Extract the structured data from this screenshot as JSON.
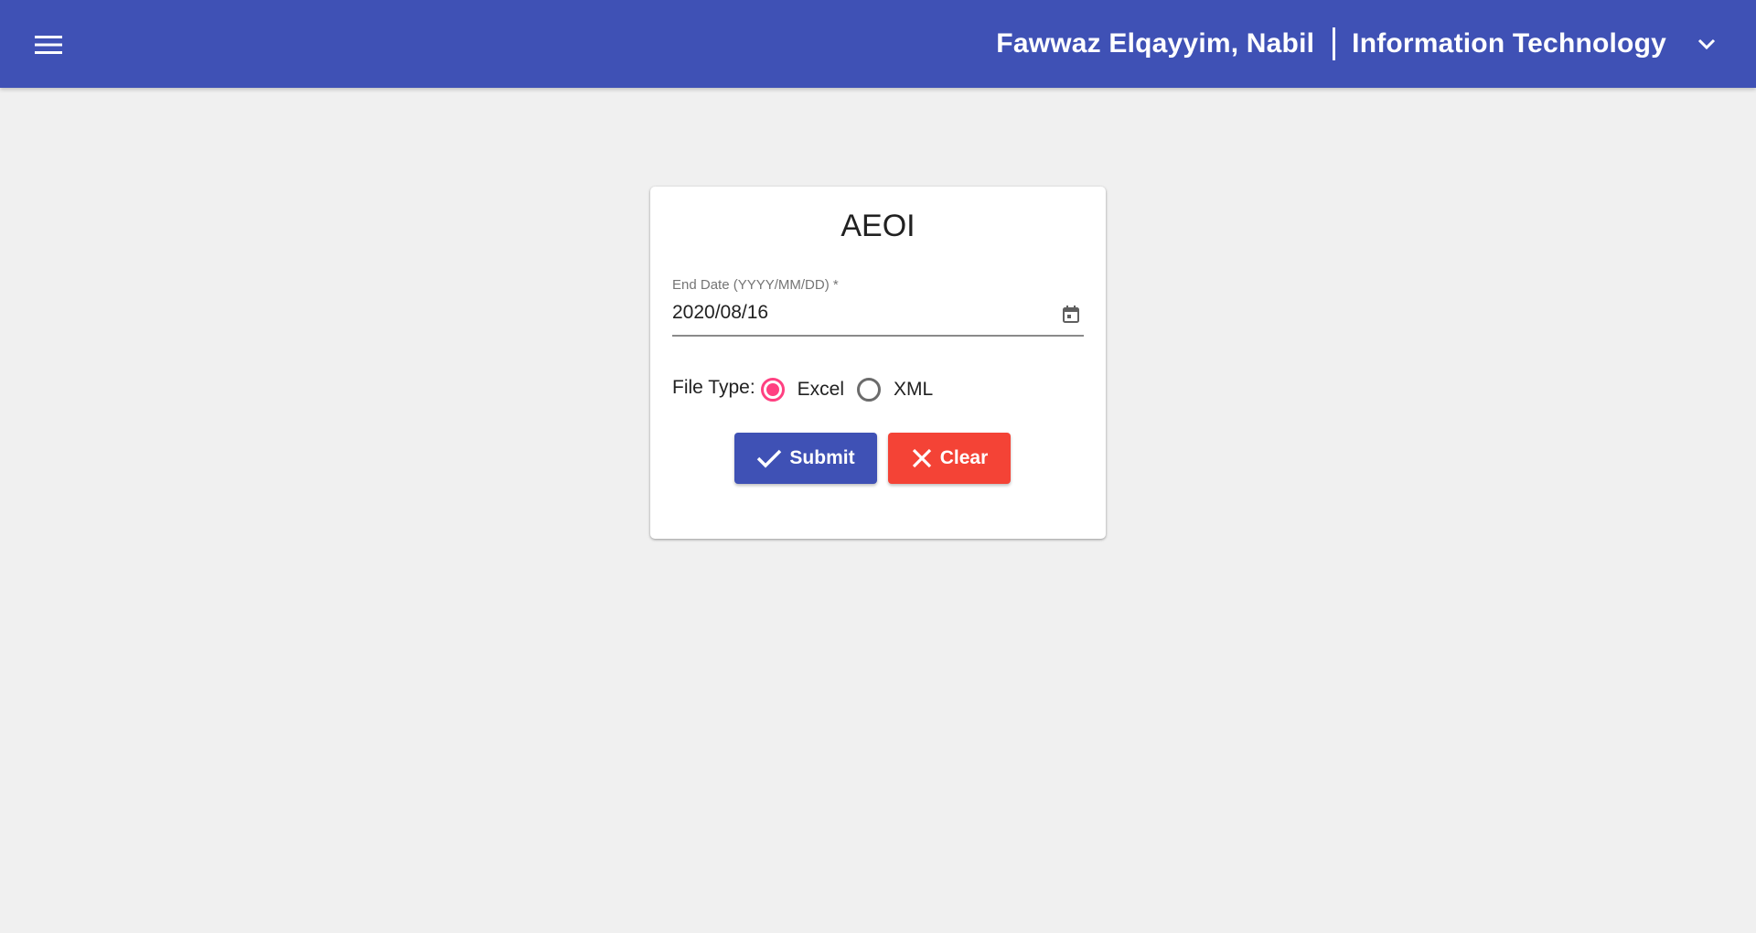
{
  "header": {
    "user_name": "Fawwaz Elqayyim, Nabil",
    "department": "Information Technology",
    "menu_icon": "menu-icon",
    "dropdown_icon": "chevron-down-icon",
    "bar_color": "#3f51b5"
  },
  "form": {
    "title": "AEOI",
    "end_date": {
      "label": "End Date (YYYY/MM/DD) *",
      "value": "2020/08/16",
      "icon": "calendar-icon"
    },
    "file_type": {
      "label": "File Type:",
      "options": [
        {
          "label": "Excel",
          "selected": true
        },
        {
          "label": "XML",
          "selected": false
        }
      ],
      "selected_color": "#ff4081"
    },
    "submit_label": "Submit",
    "clear_label": "Clear",
    "submit_icon": "check-icon",
    "clear_icon": "close-icon",
    "submit_color": "#3f51b5",
    "clear_color": "#f44336"
  }
}
